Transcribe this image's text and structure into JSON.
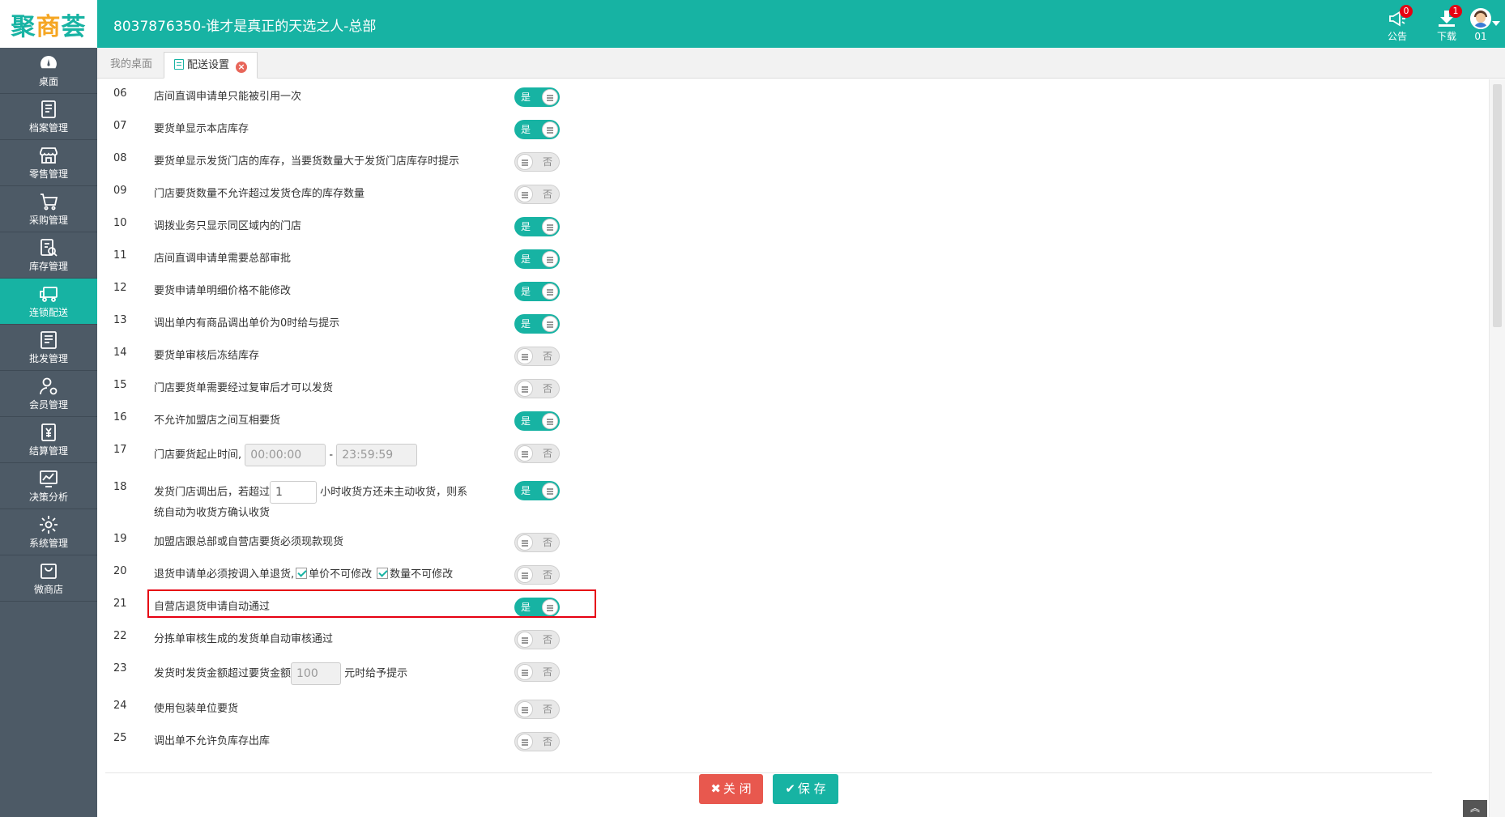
{
  "header": {
    "logo": {
      "part1": "聚",
      "part2": "商",
      "part3": "荟"
    },
    "title": "8037876350-谁才是真正的天选之人-总部",
    "announce": {
      "label": "公告",
      "badge": "0"
    },
    "download": {
      "label": "下载",
      "badge": "1"
    },
    "user": {
      "label": "01"
    }
  },
  "sidebar": {
    "items": [
      {
        "label": "桌面",
        "icon": "dashboard-icon"
      },
      {
        "label": "档案管理",
        "icon": "archive-icon"
      },
      {
        "label": "零售管理",
        "icon": "store-icon"
      },
      {
        "label": "采购管理",
        "icon": "cart-icon"
      },
      {
        "label": "库存管理",
        "icon": "inventory-icon"
      },
      {
        "label": "连锁配送",
        "icon": "truck-icon"
      },
      {
        "label": "批发管理",
        "icon": "wholesale-icon"
      },
      {
        "label": "会员管理",
        "icon": "member-icon"
      },
      {
        "label": "结算管理",
        "icon": "settlement-icon"
      },
      {
        "label": "决策分析",
        "icon": "chart-icon"
      },
      {
        "label": "系统管理",
        "icon": "gear-icon"
      },
      {
        "label": "微商店",
        "icon": "bag-icon"
      }
    ],
    "active_index": 5
  },
  "tabs": {
    "home": "我的桌面",
    "active": "配送设置"
  },
  "labels": {
    "on": "是",
    "off": "否",
    "dash": "-"
  },
  "settings": [
    {
      "num": "06",
      "text": "店间直调申请单只能被引用一次",
      "on": true
    },
    {
      "num": "07",
      "text": "要货单显示本店库存",
      "on": true
    },
    {
      "num": "08",
      "text": "要货单显示发货门店的库存，当要货数量大于发货门店库存时提示",
      "on": false
    },
    {
      "num": "09",
      "text": "门店要货数量不允许超过发货仓库的库存数量",
      "on": false
    },
    {
      "num": "10",
      "text": "调拨业务只显示同区域内的门店",
      "on": true
    },
    {
      "num": "11",
      "text": "店间直调申请单需要总部审批",
      "on": true
    },
    {
      "num": "12",
      "text": "要货申请单明细价格不能修改",
      "on": true
    },
    {
      "num": "13",
      "text": "调出单内有商品调出单价为0时给与提示",
      "on": true
    },
    {
      "num": "14",
      "text": "要货单审核后冻结库存",
      "on": false
    },
    {
      "num": "15",
      "text": "门店要货单需要经过复审后才可以发货",
      "on": false
    },
    {
      "num": "16",
      "text": "不允许加盟店之间互相要货",
      "on": true
    },
    {
      "num": "17",
      "text": "门店要货起止时间",
      "start": "00:00:00",
      "end": "23:59:59",
      "on": false
    },
    {
      "num": "18",
      "text_a": "发货门店调出后，若超过",
      "value": "1",
      "text_b": "小时收货方还未主动收货，则系",
      "text_c": "统自动为收货方确认收货",
      "on": true
    },
    {
      "num": "19",
      "text": "加盟店跟总部或自营店要货必须现款现货",
      "on": false
    },
    {
      "num": "20",
      "text": "退货申请单必须按调入单退货,",
      "chk1": "单价不可修改",
      "chk2": "数量不可修改",
      "on": false
    },
    {
      "num": "21",
      "text": "自营店退货申请自动通过",
      "on": true
    },
    {
      "num": "22",
      "text": "分拣单审核生成的发货单自动审核通过",
      "on": false
    },
    {
      "num": "23",
      "text_a": "发货时发货金额超过要货金额",
      "value": "100",
      "text_b": "元时给予提示",
      "on": false
    },
    {
      "num": "24",
      "text": "使用包装单位要货",
      "on": false
    },
    {
      "num": "25",
      "text": "调出单不允许负库存出库",
      "on": false
    }
  ],
  "buttons": {
    "close": {
      "icon": "✖",
      "label": "关 闭"
    },
    "save": {
      "icon": "✔",
      "label": "保 存"
    }
  },
  "colors": {
    "accent": "#17b3a3",
    "sidebar": "#4d5a66",
    "danger": "#e8584e",
    "highlight": "#e60012"
  }
}
